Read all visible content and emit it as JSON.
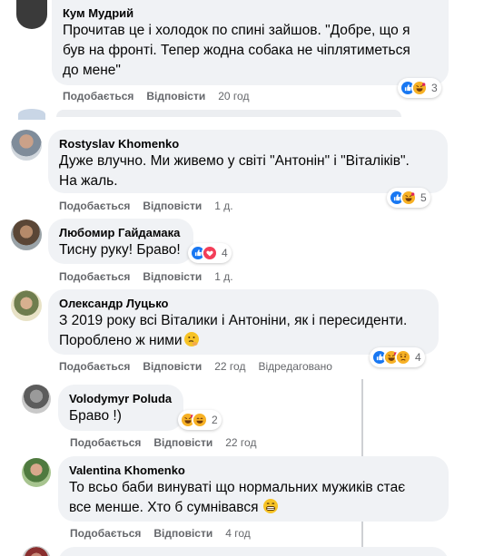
{
  "colors": {
    "bubble": "#f0f2f5",
    "meta": "#65676b",
    "like": "#1877f2",
    "love": "#f33e58",
    "haha": "#f7b125"
  },
  "comments": [
    {
      "name": "Кум Мудрий",
      "lines": [
        "Прочитав це і холодок по спині зайшов. \"Добре, що я",
        "був на фронті. Тепер жодна собака не чіплятиметься",
        "до мене\""
      ],
      "like": "Подобається",
      "reply": "Відповісти",
      "time": "20 год",
      "edited": "",
      "reactions": [
        "like-icon",
        "haha-icon"
      ],
      "count": "3"
    },
    {
      "name": "Rostyslav Khomenko",
      "lines": [
        "Дуже влучно. Ми живемо у світі \"Антонін\" і \"Віталіків\".",
        "На жаль."
      ],
      "like": "Подобається",
      "reply": "Відповісти",
      "time": "1 д.",
      "edited": "",
      "reactions": [
        "like-icon",
        "haha-icon"
      ],
      "count": "5"
    },
    {
      "name": "Любомир Гайдамака",
      "lines": [
        "Тисну руку! Браво!"
      ],
      "like": "Подобається",
      "reply": "Відповісти",
      "time": "1 д.",
      "edited": "",
      "reactions": [
        "like-icon",
        "love-icon"
      ],
      "count": "4"
    },
    {
      "name": "Олександр Луцько",
      "lines": [
        "З 2019 року всі Віталики і Антоніни, як і пересиденти.",
        "Пороблено ж ними"
      ],
      "like": "Подобається",
      "reply": "Відповісти",
      "time": "22 год",
      "edited": "Відредаговано",
      "reactions": [
        "like-icon",
        "haha-icon",
        "sad-icon"
      ],
      "count": "4"
    },
    {
      "name": "Volodymyr Poluda",
      "lines": [
        "Браво !)"
      ],
      "like": "Подобається",
      "reply": "Відповісти",
      "time": "22 год",
      "edited": "",
      "reactions": [
        "haha-icon",
        "laugh-icon"
      ],
      "count": "2"
    },
    {
      "name": "Valentina Khomenko",
      "lines": [
        "То всьо баби винуваті що нормальних мужиків стає",
        "все менше. Хто б сумнівався"
      ],
      "like": "Подобається",
      "reply": "Відповісти",
      "time": "4 год",
      "edited": "",
      "reactions": [],
      "count": ""
    }
  ]
}
